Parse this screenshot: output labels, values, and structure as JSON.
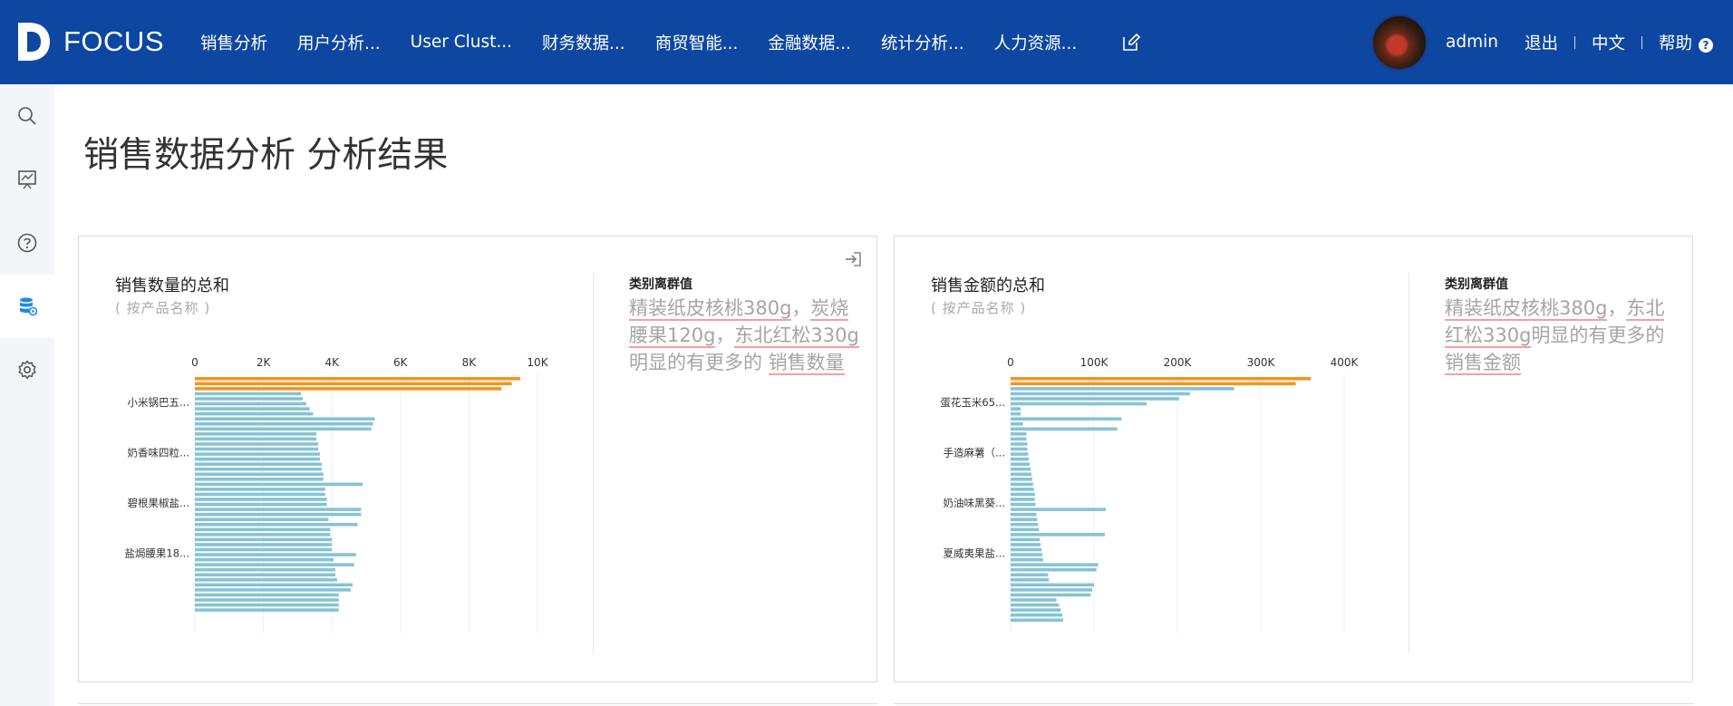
{
  "brand": {
    "name": "FOCUS"
  },
  "nav": {
    "items": [
      "销售分析",
      "用户分析...",
      "User Clust...",
      "财务数据...",
      "商贸智能...",
      "金融数据...",
      "统计分析...",
      "人力资源..."
    ],
    "edit_icon": "edit-icon"
  },
  "user": {
    "name": "admin",
    "logout": "退出",
    "language": "中文",
    "help": "帮助",
    "help_icon": "?"
  },
  "sidebar": {
    "icons": [
      "search-icon",
      "dashboard-icon",
      "help-icon",
      "database-icon",
      "settings-icon"
    ],
    "active_index": 3
  },
  "page": {
    "title": "销售数据分析 分析结果"
  },
  "colors": {
    "brand": "#0d47a1",
    "outlier_bar": "#f5931f",
    "normal_bar": "#86c3d4",
    "underline": "#f4a09a"
  },
  "cards": [
    {
      "title": "销售数量的总和",
      "subtitle": "( 按产品名称 )",
      "outlier_heading": "类别离群值",
      "outlier_parts": [
        {
          "text": "精装纸皮核桃380g",
          "u": true
        },
        {
          "text": "，",
          "u": false
        },
        {
          "text": "炭烧腰果120g",
          "u": true
        },
        {
          "text": "，",
          "u": false
        },
        {
          "text": "东北红松330g",
          "u": true
        },
        {
          "text": "明显的有更多的 ",
          "u": false
        },
        {
          "text": "销售数量",
          "u": true
        }
      ]
    },
    {
      "title": "销售金额的总和",
      "subtitle": "( 按产品名称 )",
      "outlier_heading": "类别离群值",
      "outlier_parts": [
        {
          "text": "精装纸皮核桃380g",
          "u": true
        },
        {
          "text": "，",
          "u": false
        },
        {
          "text": "东北红松330g",
          "u": true
        },
        {
          "text": "明显的有更多的 ",
          "u": false
        },
        {
          "text": "销售金额",
          "u": true
        }
      ]
    }
  ],
  "chart_data": [
    {
      "type": "bar",
      "orientation": "horizontal",
      "xlim": [
        0,
        10000
      ],
      "x_ticks": [
        "0",
        "2K",
        "4K",
        "6K",
        "8K",
        "10K"
      ],
      "y_tick_labels": [
        "小米锅巴五...",
        "奶香味四粒...",
        "碧根果椒盐...",
        "盐焗腰果18..."
      ],
      "values": [
        9500,
        9250,
        8950,
        3100,
        3150,
        3250,
        3350,
        3450,
        5250,
        5200,
        5150,
        3550,
        3550,
        3600,
        3600,
        3650,
        3650,
        3700,
        3700,
        3750,
        3750,
        4900,
        3800,
        3800,
        3850,
        3850,
        4850,
        4850,
        3900,
        4750,
        3950,
        3950,
        4000,
        4000,
        4000,
        4700,
        4050,
        4650,
        4100,
        4100,
        4150,
        4600,
        4550,
        4200,
        4200,
        4200,
        4200
      ],
      "outliers_count": 3
    },
    {
      "type": "bar",
      "orientation": "horizontal",
      "xlim": [
        0,
        400000
      ],
      "x_ticks": [
        "0",
        "100K",
        "200K",
        "300K",
        "400K"
      ],
      "y_tick_labels": [
        "蛋花玉米65...",
        "手造麻薯（...",
        "奶油味黑葵...",
        "夏威夷果盐..."
      ],
      "values": [
        360000,
        342000,
        268000,
        215000,
        202000,
        163000,
        12000,
        12000,
        133000,
        15000,
        128000,
        19000,
        19000,
        20000,
        20000,
        21000,
        22000,
        23000,
        24000,
        25000,
        26000,
        27000,
        28000,
        29000,
        29000,
        30000,
        114000,
        31000,
        32000,
        33000,
        34000,
        113000,
        35000,
        36000,
        37000,
        38000,
        39000,
        105000,
        103000,
        45000,
        46000,
        100000,
        98000,
        96000,
        55000,
        58000,
        60000,
        62000,
        63000
      ],
      "outliers_count": 2
    }
  ]
}
